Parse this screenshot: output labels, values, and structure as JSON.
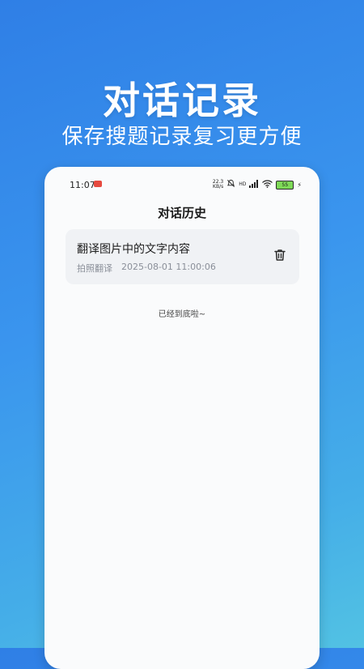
{
  "promo": {
    "title": "对话记录",
    "subtitle": "保存搜题记录复习更方便"
  },
  "status_bar": {
    "time": "11:07",
    "net_speed_value": "22.3",
    "net_speed_unit": "KB/s",
    "signal_label": "HD",
    "battery": "55",
    "icons": [
      "mute-icon",
      "signal-icon",
      "wifi-icon",
      "battery-icon",
      "charging-icon"
    ]
  },
  "header": {
    "title": "对话历史"
  },
  "records": [
    {
      "title": "翻译图片中的文字内容",
      "type": "拍照翻译",
      "timestamp": "2025-08-01 11:00:06"
    }
  ],
  "list_end_text": "已经到底啦~",
  "colors": {
    "background_gradient_start": "#2f7fe6",
    "background_gradient_end": "#52c2e3",
    "card_background": "#f0f2f5",
    "battery_fill": "#7ed957"
  }
}
